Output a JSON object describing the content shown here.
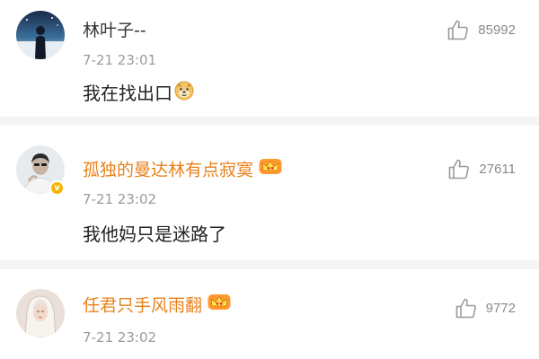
{
  "comments": [
    {
      "username": "林叶子--",
      "time": "7-21 23:01",
      "text": "我在找出口",
      "emoji": "doge-emoji",
      "likes": "85992",
      "vip": false,
      "verified": false
    },
    {
      "username": "孤独的曼达林有点寂寞",
      "time": "7-21 23:02",
      "text": "我他妈只是迷路了",
      "likes": "27611",
      "vip": true,
      "verified": true
    },
    {
      "username": "任君只手风雨翻",
      "time": "7-21 23:02",
      "likes": "9772",
      "vip": true,
      "verified": false
    }
  ],
  "colors": {
    "vip_name": "#e8811a",
    "plain_name": "#333333",
    "timestamp": "#9b9b9b",
    "like_icon": "#9a9a9a",
    "divider": "#f4f4f4",
    "verified_badge": "#f5b400"
  }
}
